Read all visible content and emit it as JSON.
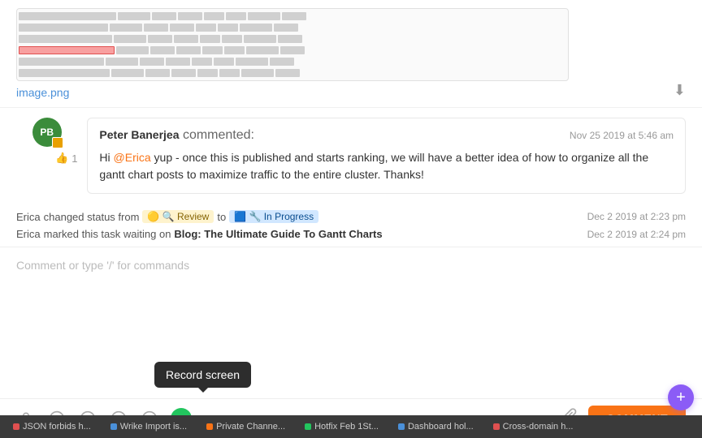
{
  "image": {
    "filename": "image.png",
    "download_icon": "⬇"
  },
  "comment": {
    "author": "Peter Banerjea",
    "action": "commented:",
    "timestamp": "Nov 25 2019 at 5:46 am",
    "mention": "@Erica",
    "text_parts": [
      "Hi ",
      " yup - once this is published and starts ranking, we will have a better idea of how to organize all the gantt chart posts to maximize traffic to the entire cluster. Thanks!"
    ],
    "like_count": "1",
    "avatar_initials": "PB"
  },
  "activity": [
    {
      "actor": "Erica",
      "action": "changed status from",
      "from_status": "🟡 🔍 Review",
      "to": "to",
      "to_status": "🟦 🔧 In Progress",
      "timestamp": "Dec 2 2019 at 2:23 pm"
    },
    {
      "actor": "Erica",
      "action": "marked this task waiting on",
      "task": "Blog: The Ultimate Guide To Gantt Charts",
      "timestamp": "Dec 2 2019 at 2:24 pm"
    }
  ],
  "input": {
    "placeholder": "Comment or type '/' for commands"
  },
  "toolbar": {
    "icons": [
      "emoji-person",
      "at-sign",
      "smiley",
      "emoji-face",
      "slash",
      "record-screen"
    ],
    "attach_icon": "📎",
    "comment_button": "COMMENT",
    "record_tooltip": "Record screen"
  },
  "taskbar": {
    "items": [
      {
        "label": "JSON forbids h...",
        "dot_color": "dot-red"
      },
      {
        "label": "Wrike Import is...",
        "dot_color": "dot-blue"
      },
      {
        "label": "Private Channe...",
        "dot_color": "dot-orange"
      },
      {
        "label": "Hotfix Feb 1St...",
        "dot_color": "dot-green"
      },
      {
        "label": "Dashboard hol...",
        "dot_color": "dot-blue"
      },
      {
        "label": "Cross-domain h...",
        "dot_color": "dot-red"
      }
    ]
  },
  "fab": {
    "label": "+"
  }
}
